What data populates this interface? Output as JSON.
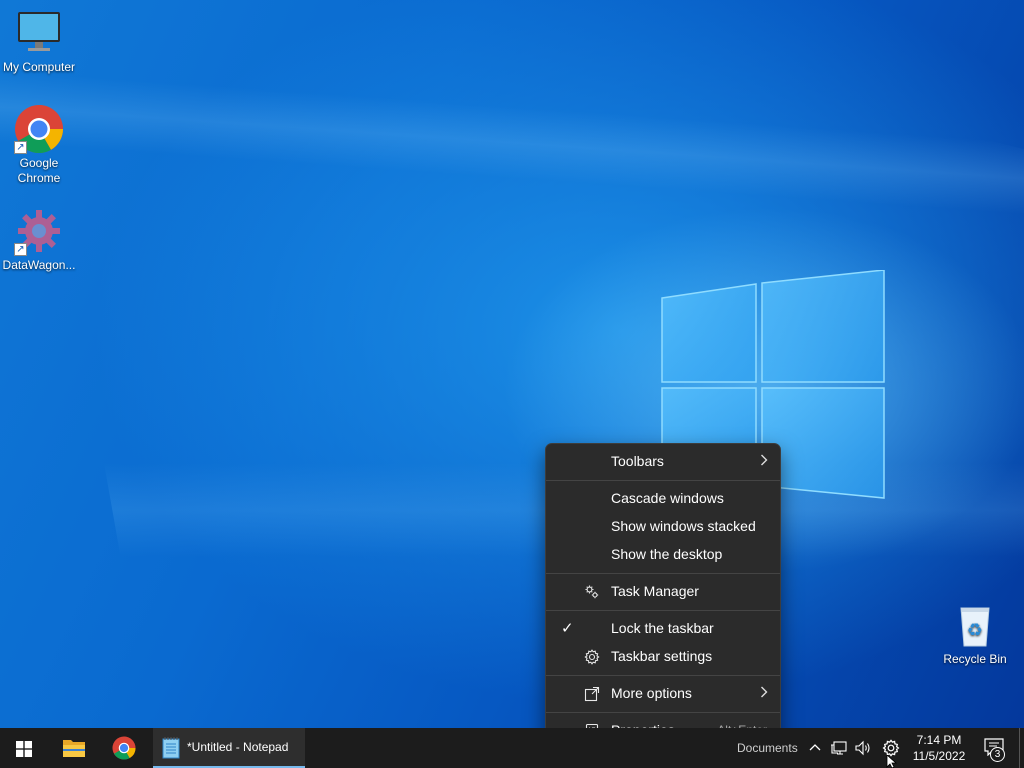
{
  "desktop": {
    "icons": [
      {
        "label": "My Computer"
      },
      {
        "label": "Google Chrome"
      },
      {
        "label": "DataWagon..."
      },
      {
        "label": "Recycle Bin"
      }
    ]
  },
  "context_menu": {
    "toolbars": "Toolbars",
    "cascade": "Cascade windows",
    "stacked": "Show windows stacked",
    "show_desktop": "Show the desktop",
    "task_manager": "Task Manager",
    "lock_taskbar": "Lock the taskbar",
    "lock_checked": "✓",
    "taskbar_settings": "Taskbar settings",
    "more_options": "More options",
    "properties": "Properties",
    "properties_accel": "Alt+Enter"
  },
  "taskbar": {
    "running_app": "*Untitled - Notepad",
    "toolbar_label": "Documents",
    "time": "7:14 PM",
    "date": "11/5/2022",
    "notification_count": "3"
  },
  "colors": {
    "taskbar": "#1c1c1c",
    "menu_bg": "#2b2b2b",
    "accent": "#76b9ed",
    "desktop": "#0a63c9"
  }
}
